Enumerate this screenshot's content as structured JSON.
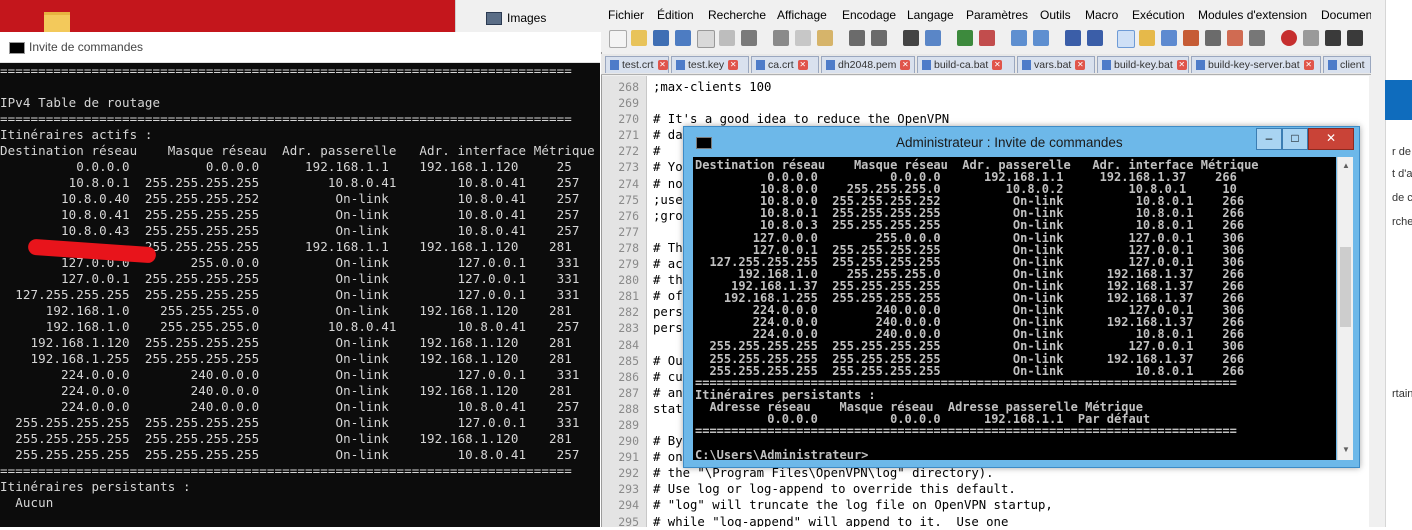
{
  "background": {
    "images_tab_label": "Images"
  },
  "cmd_left": {
    "title": "Invite de commandes",
    "console_text": "===========================================================================\n\nIPv4 Table de routage\n===========================================================================\nItinéraires actifs :\nDestination réseau    Masque réseau  Adr. passerelle   Adr. interface Métrique\n          0.0.0.0          0.0.0.0      192.168.1.1    192.168.1.120     25\n         10.8.0.1  255.255.255.255         10.8.0.41        10.8.0.41    257\n        10.8.0.40  255.255.255.252          On-link         10.8.0.41    257\n        10.8.0.41  255.255.255.255          On-link         10.8.0.41    257\n        10.8.0.43  255.255.255.255          On-link         10.8.0.41    257\n                   255.255.255.255      192.168.1.1    192.168.1.120    281\n        127.0.0.0        255.0.0.0          On-link         127.0.0.1    331\n        127.0.0.1  255.255.255.255          On-link         127.0.0.1    331\n  127.255.255.255  255.255.255.255          On-link         127.0.0.1    331\n      192.168.1.0    255.255.255.0          On-link    192.168.1.120    281\n      192.168.1.0    255.255.255.0         10.8.0.41        10.8.0.41    257\n    192.168.1.120  255.255.255.255          On-link    192.168.1.120    281\n    192.168.1.255  255.255.255.255          On-link    192.168.1.120    281\n        224.0.0.0        240.0.0.0          On-link         127.0.0.1    331\n        224.0.0.0        240.0.0.0          On-link    192.168.1.120    281\n        224.0.0.0        240.0.0.0          On-link         10.8.0.41    257\n  255.255.255.255  255.255.255.255          On-link         127.0.0.1    331\n  255.255.255.255  255.255.255.255          On-link    192.168.1.120    281\n  255.255.255.255  255.255.255.255          On-link         10.8.0.41    257\n===========================================================================\nItinéraires persistants :\n  Aucun"
  },
  "npp": {
    "menu": [
      "Fichier",
      "Édition",
      "Recherche",
      "Affichage",
      "Encodage",
      "Langage",
      "Paramètres",
      "Outils",
      "Macro",
      "Exécution",
      "Modules d'extension",
      "Documents"
    ],
    "tabs": [
      "test.crt",
      "test.key",
      "ca.crt",
      "dh2048.pem",
      "build-ca.bat",
      "vars.bat",
      "build-key.bat",
      "build-key-server.bat",
      "client"
    ],
    "line_numbers": "268\n269\n270\n271\n272\n273\n274\n275\n276\n277\n278\n279\n280\n281\n282\n283\n284\n285\n286\n287\n288\n289\n290\n291\n292\n293\n294\n295",
    "editor_text": ";max-clients 100\n\n# It's a good idea to reduce the OpenVPN\n# da\n#\n# Yo\n# no\n;use\n;gro\n\n# Th\n# ac\n# th\n# of\npers\npers\n\n# Ou\n# cu\n# an\nstat\n\n# By\n# on\n# the \"\\Program Files\\OpenVPN\\log\" directory).\n# Use log or log-append to override this default.\n# \"log\" will truncate the log file on OpenVPN startup,\n# while \"log-append\" will append to it.  Use one"
  },
  "right_partial": {
    "texts": [
      "r de",
      "t d'a",
      "de co",
      "rche",
      "rtaine"
    ]
  },
  "cmd_admin": {
    "title": "Administrateur : Invite de commandes",
    "minimize": "–",
    "maximize": "□",
    "close": "✕",
    "console_text": "Destination réseau    Masque réseau  Adr. passerelle   Adr. interface Métrique\n          0.0.0.0          0.0.0.0      192.168.1.1     192.168.1.37    266\n         10.8.0.0    255.255.255.0         10.8.0.2         10.8.0.1     10\n         10.8.0.0  255.255.255.252          On-link          10.8.0.1    266\n         10.8.0.1  255.255.255.255          On-link          10.8.0.1    266\n         10.8.0.3  255.255.255.255          On-link          10.8.0.1    266\n        127.0.0.0        255.0.0.0          On-link         127.0.0.1    306\n        127.0.0.1  255.255.255.255          On-link         127.0.0.1    306\n  127.255.255.255  255.255.255.255          On-link         127.0.0.1    306\n      192.168.1.0    255.255.255.0          On-link      192.168.1.37    266\n     192.168.1.37  255.255.255.255          On-link      192.168.1.37    266\n    192.168.1.255  255.255.255.255          On-link      192.168.1.37    266\n        224.0.0.0        240.0.0.0          On-link         127.0.0.1    306\n        224.0.0.0        240.0.0.0          On-link      192.168.1.37    266\n        224.0.0.0        240.0.0.0          On-link          10.8.0.1    266\n  255.255.255.255  255.255.255.255          On-link         127.0.0.1    306\n  255.255.255.255  255.255.255.255          On-link      192.168.1.37    266\n  255.255.255.255  255.255.255.255          On-link          10.8.0.1    266\n===========================================================================\nItinéraires persistants :\n  Adresse réseau    Masque réseau  Adresse passerelle Métrique\n          0.0.0.0          0.0.0.0      192.168.1.1  Par défaut\n===========================================================================\n\nC:\\Users\\Administrateur>_"
  }
}
